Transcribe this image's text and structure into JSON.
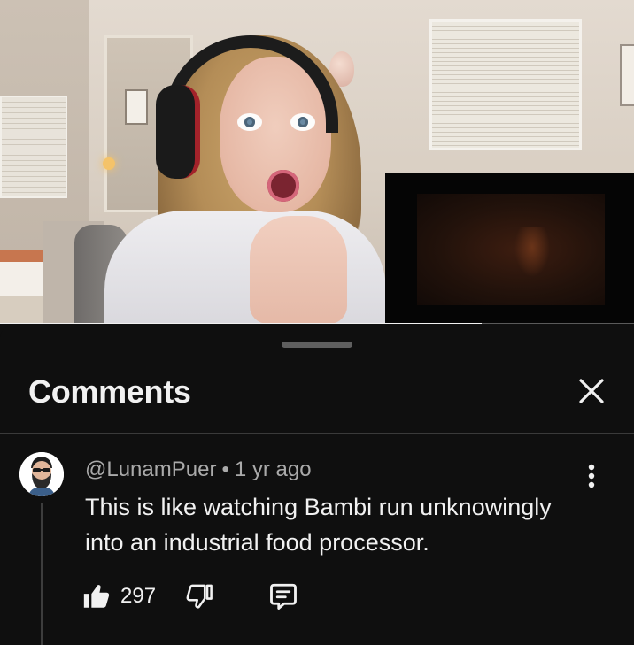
{
  "video": {
    "progress_fraction": 0.76
  },
  "comments_panel": {
    "title": "Comments"
  },
  "comment": {
    "author": "@LunamPuer",
    "separator": "•",
    "time": "1 yr ago",
    "text": "This is like watching Bambi run unknowingly into an industrial food processor.",
    "likes": "297"
  },
  "icons": {
    "close": "close-icon",
    "more": "more-vertical-icon",
    "like": "thumbs-up-icon",
    "dislike": "thumbs-down-icon",
    "reply": "reply-comment-icon"
  },
  "colors": {
    "background": "#0f0f0f",
    "text_primary": "#f1f1f1",
    "text_secondary": "#aaaaaa",
    "divider": "#3a3a3a"
  }
}
